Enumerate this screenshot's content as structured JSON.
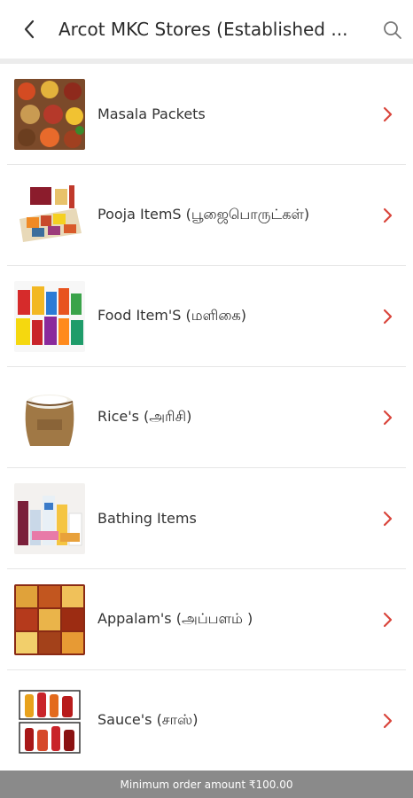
{
  "header": {
    "title": "Arcot MKC Stores (Established ...",
    "back_icon": "chevron-left-icon",
    "search_icon": "search-icon"
  },
  "categories": [
    {
      "label": "Masala Packets"
    },
    {
      "label": "Pooja ItemS (பூஜைபொருட்கள்)"
    },
    {
      "label": "Food Item'S (மளிகை)"
    },
    {
      "label": "Rice's (அரிசி)"
    },
    {
      "label": "Bathing Items"
    },
    {
      "label": "Appalam's (அப்பளம் )"
    },
    {
      "label": "Sauce's (சாஸ்)"
    }
  ],
  "footer": {
    "text": "Minimum order amount ₹100.00"
  },
  "colors": {
    "accent_chevron": "#d9453b",
    "footer_bg": "#8a8a8a"
  }
}
